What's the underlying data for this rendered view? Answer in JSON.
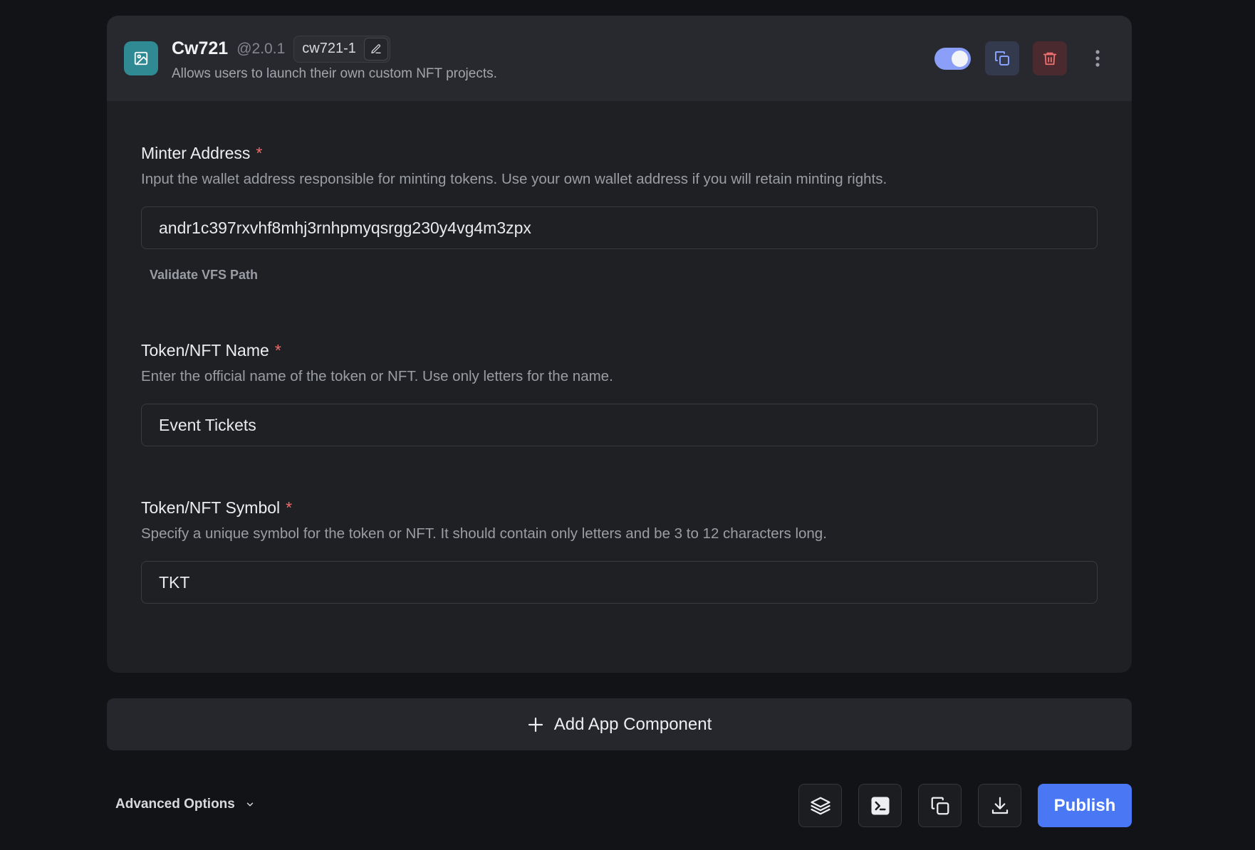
{
  "component": {
    "title": "Cw721",
    "version": "@2.0.1",
    "instance_name": "cw721-1",
    "description": "Allows users to launch their own custom NFT projects.",
    "enabled": true,
    "icons": {
      "app": "image-icon",
      "edit": "pencil-icon",
      "duplicate": "copy-icon",
      "delete": "trash-icon",
      "more": "more-vertical-icon"
    }
  },
  "fields": [
    {
      "label": "Minter Address",
      "required_mark": "*",
      "help": "Input the wallet address responsible for minting tokens. Use your own wallet address if you will retain minting rights.",
      "value": "andr1c397rxvhf8mhj3rnhpmyqsrgg230y4vg4m3zpx",
      "link": "Validate VFS Path"
    },
    {
      "label": "Token/NFT Name",
      "required_mark": "*",
      "help": "Enter the official name of the token or NFT. Use only letters for the name.",
      "value": "Event Tickets"
    },
    {
      "label": "Token/NFT Symbol",
      "required_mark": "*",
      "help": "Specify a unique symbol for the token or NFT. It should contain only letters and be 3 to 12 characters long.",
      "value": "TKT"
    }
  ],
  "add_component": {
    "label": "Add App Component",
    "icon": "plus-icon"
  },
  "footer": {
    "advanced_label": "Advanced Options",
    "tools": [
      "layers-icon",
      "terminal-icon",
      "copy-icon",
      "download-icon"
    ],
    "publish_label": "Publish"
  },
  "colors": {
    "accent": "#4a78f5",
    "toggle": "#8b9ef8",
    "required": "#f06b6b",
    "app_icon_bg": "#2f8a93"
  }
}
